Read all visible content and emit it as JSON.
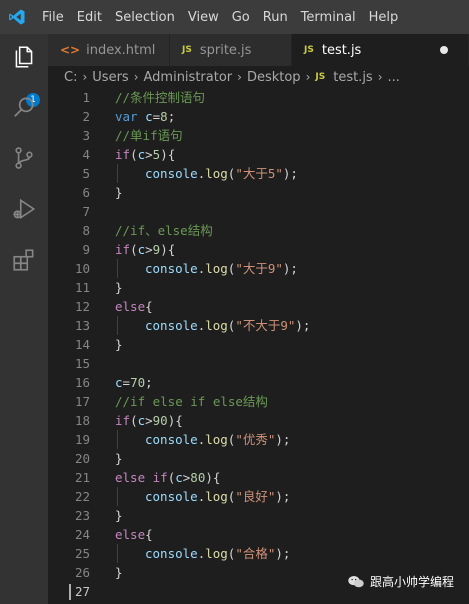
{
  "menubar": {
    "items": [
      "File",
      "Edit",
      "Selection",
      "View",
      "Go",
      "Run",
      "Terminal",
      "Help"
    ]
  },
  "activity_bar": {
    "explorer_badge": "1"
  },
  "tabs": [
    {
      "label": "index.html",
      "icon": "html-file-icon",
      "icon_text": "<>"
    },
    {
      "label": "sprite.js",
      "icon": "js-file-icon",
      "icon_text": "JS"
    },
    {
      "label": "test.js",
      "icon": "js-file-icon",
      "icon_text": "JS",
      "active": true,
      "modified": true
    }
  ],
  "breadcrumb": {
    "segments": [
      "C:",
      "Users",
      "Administrator",
      "Desktop"
    ],
    "file_icon_text": "JS",
    "file": "test.js",
    "more": "..."
  },
  "editor": {
    "current_line": 27,
    "lines": [
      {
        "n": "1",
        "indent": 0,
        "tokens": [
          {
            "t": "//条件控制语句",
            "c": "#6a9955"
          }
        ]
      },
      {
        "n": "2",
        "indent": 0,
        "tokens": [
          {
            "t": "var",
            "c": "#569cd6"
          },
          {
            "t": " ",
            "c": "#d4d4d4"
          },
          {
            "t": "c",
            "c": "#9cdcfe"
          },
          {
            "t": "=",
            "c": "#d4d4d4"
          },
          {
            "t": "8",
            "c": "#b5cea8"
          },
          {
            "t": ";",
            "c": "#d4d4d4"
          }
        ]
      },
      {
        "n": "3",
        "indent": 0,
        "tokens": [
          {
            "t": "//单if语句",
            "c": "#6a9955"
          }
        ]
      },
      {
        "n": "4",
        "indent": 0,
        "tokens": [
          {
            "t": "if",
            "c": "#c586c0"
          },
          {
            "t": "(",
            "c": "#d4d4d4"
          },
          {
            "t": "c",
            "c": "#9cdcfe"
          },
          {
            "t": ">",
            "c": "#d4d4d4"
          },
          {
            "t": "5",
            "c": "#b5cea8"
          },
          {
            "t": "){",
            "c": "#d4d4d4"
          }
        ]
      },
      {
        "n": "5",
        "indent": 1,
        "tokens": [
          {
            "t": "console",
            "c": "#9cdcfe"
          },
          {
            "t": ".",
            "c": "#d4d4d4"
          },
          {
            "t": "log",
            "c": "#dcdcaa"
          },
          {
            "t": "(",
            "c": "#d4d4d4"
          },
          {
            "t": "\"大于5\"",
            "c": "#ce9178"
          },
          {
            "t": ");",
            "c": "#d4d4d4"
          }
        ]
      },
      {
        "n": "6",
        "indent": 0,
        "tokens": [
          {
            "t": "}",
            "c": "#d4d4d4"
          }
        ]
      },
      {
        "n": "7",
        "indent": 0,
        "tokens": []
      },
      {
        "n": "8",
        "indent": 0,
        "tokens": [
          {
            "t": "//if、else结构",
            "c": "#6a9955"
          }
        ]
      },
      {
        "n": "9",
        "indent": 0,
        "tokens": [
          {
            "t": "if",
            "c": "#c586c0"
          },
          {
            "t": "(",
            "c": "#d4d4d4"
          },
          {
            "t": "c",
            "c": "#9cdcfe"
          },
          {
            "t": ">",
            "c": "#d4d4d4"
          },
          {
            "t": "9",
            "c": "#b5cea8"
          },
          {
            "t": "){",
            "c": "#d4d4d4"
          }
        ]
      },
      {
        "n": "10",
        "indent": 1,
        "tokens": [
          {
            "t": "console",
            "c": "#9cdcfe"
          },
          {
            "t": ".",
            "c": "#d4d4d4"
          },
          {
            "t": "log",
            "c": "#dcdcaa"
          },
          {
            "t": "(",
            "c": "#d4d4d4"
          },
          {
            "t": "\"大于9\"",
            "c": "#ce9178"
          },
          {
            "t": ");",
            "c": "#d4d4d4"
          }
        ]
      },
      {
        "n": "11",
        "indent": 0,
        "tokens": [
          {
            "t": "}",
            "c": "#d4d4d4"
          }
        ]
      },
      {
        "n": "12",
        "indent": 0,
        "tokens": [
          {
            "t": "else",
            "c": "#c586c0"
          },
          {
            "t": "{",
            "c": "#d4d4d4"
          }
        ]
      },
      {
        "n": "13",
        "indent": 1,
        "tokens": [
          {
            "t": "console",
            "c": "#9cdcfe"
          },
          {
            "t": ".",
            "c": "#d4d4d4"
          },
          {
            "t": "log",
            "c": "#dcdcaa"
          },
          {
            "t": "(",
            "c": "#d4d4d4"
          },
          {
            "t": "\"不大于9\"",
            "c": "#ce9178"
          },
          {
            "t": ");",
            "c": "#d4d4d4"
          }
        ]
      },
      {
        "n": "14",
        "indent": 0,
        "tokens": [
          {
            "t": "}",
            "c": "#d4d4d4"
          }
        ]
      },
      {
        "n": "15",
        "indent": 0,
        "tokens": []
      },
      {
        "n": "16",
        "indent": 0,
        "tokens": [
          {
            "t": "c",
            "c": "#9cdcfe"
          },
          {
            "t": "=",
            "c": "#d4d4d4"
          },
          {
            "t": "70",
            "c": "#b5cea8"
          },
          {
            "t": ";",
            "c": "#d4d4d4"
          }
        ]
      },
      {
        "n": "17",
        "indent": 0,
        "tokens": [
          {
            "t": "//if else if else结构",
            "c": "#6a9955"
          }
        ]
      },
      {
        "n": "18",
        "indent": 0,
        "tokens": [
          {
            "t": "if",
            "c": "#c586c0"
          },
          {
            "t": "(",
            "c": "#d4d4d4"
          },
          {
            "t": "c",
            "c": "#9cdcfe"
          },
          {
            "t": ">",
            "c": "#d4d4d4"
          },
          {
            "t": "90",
            "c": "#b5cea8"
          },
          {
            "t": "){",
            "c": "#d4d4d4"
          }
        ]
      },
      {
        "n": "19",
        "indent": 1,
        "tokens": [
          {
            "t": "console",
            "c": "#9cdcfe"
          },
          {
            "t": ".",
            "c": "#d4d4d4"
          },
          {
            "t": "log",
            "c": "#dcdcaa"
          },
          {
            "t": "(",
            "c": "#d4d4d4"
          },
          {
            "t": "\"优秀\"",
            "c": "#ce9178"
          },
          {
            "t": ");",
            "c": "#d4d4d4"
          }
        ]
      },
      {
        "n": "20",
        "indent": 0,
        "tokens": [
          {
            "t": "}",
            "c": "#d4d4d4"
          }
        ]
      },
      {
        "n": "21",
        "indent": 0,
        "tokens": [
          {
            "t": "else",
            "c": "#c586c0"
          },
          {
            "t": " ",
            "c": "#d4d4d4"
          },
          {
            "t": "if",
            "c": "#c586c0"
          },
          {
            "t": "(",
            "c": "#d4d4d4"
          },
          {
            "t": "c",
            "c": "#9cdcfe"
          },
          {
            "t": ">",
            "c": "#d4d4d4"
          },
          {
            "t": "80",
            "c": "#b5cea8"
          },
          {
            "t": "){",
            "c": "#d4d4d4"
          }
        ]
      },
      {
        "n": "22",
        "indent": 1,
        "tokens": [
          {
            "t": "console",
            "c": "#9cdcfe"
          },
          {
            "t": ".",
            "c": "#d4d4d4"
          },
          {
            "t": "log",
            "c": "#dcdcaa"
          },
          {
            "t": "(",
            "c": "#d4d4d4"
          },
          {
            "t": "\"良好\"",
            "c": "#ce9178"
          },
          {
            "t": ");",
            "c": "#d4d4d4"
          }
        ]
      },
      {
        "n": "23",
        "indent": 0,
        "tokens": [
          {
            "t": "}",
            "c": "#d4d4d4"
          }
        ]
      },
      {
        "n": "24",
        "indent": 0,
        "tokens": [
          {
            "t": "else",
            "c": "#c586c0"
          },
          {
            "t": "{",
            "c": "#d4d4d4"
          }
        ]
      },
      {
        "n": "25",
        "indent": 1,
        "tokens": [
          {
            "t": "console",
            "c": "#9cdcfe"
          },
          {
            "t": ".",
            "c": "#d4d4d4"
          },
          {
            "t": "log",
            "c": "#dcdcaa"
          },
          {
            "t": "(",
            "c": "#d4d4d4"
          },
          {
            "t": "\"合格\"",
            "c": "#ce9178"
          },
          {
            "t": ");",
            "c": "#d4d4d4"
          }
        ]
      },
      {
        "n": "26",
        "indent": 0,
        "tokens": [
          {
            "t": "}",
            "c": "#d4d4d4"
          }
        ]
      },
      {
        "n": "27",
        "indent": 0,
        "tokens": []
      }
    ]
  },
  "watermark": {
    "text": "跟高小帅学编程",
    "icon": "wechat-icon"
  }
}
